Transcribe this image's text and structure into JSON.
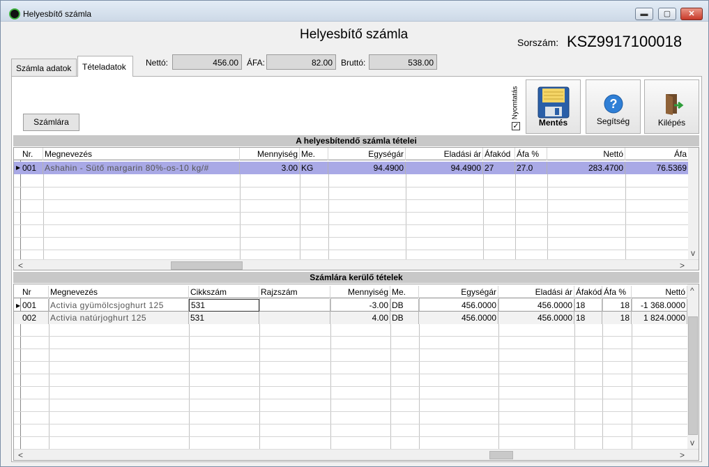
{
  "window": {
    "title": "Helyesbítő számla",
    "minimize": "▬",
    "maximize": "▢",
    "close": "✕"
  },
  "header": {
    "heading": "Helyesbítő számla",
    "sorszam_label": "Sorszám:",
    "sorszam_value": "KSZ9917100018"
  },
  "tabs": [
    {
      "label": "Számla adatok"
    },
    {
      "label": "Tételadatok"
    }
  ],
  "totals": {
    "netto_label": "Nettó:",
    "netto_value": "456.00",
    "afa_label": "ÁFA:",
    "afa_value": "82.00",
    "brutto_label": "Bruttó:",
    "brutto_value": "538.00"
  },
  "toolbar": {
    "szamlara_label": "Számlára",
    "print_label": "Nyomtatás",
    "print_checked": "✓",
    "save_label": "Mentés",
    "help_label": "Segítség",
    "exit_label": "Kilépés"
  },
  "grid1": {
    "title": "A helyesbítendő számla tételei",
    "headers": [
      "Nr.",
      "Megnevezés",
      "Mennyiség",
      "Me.",
      "Egységár",
      "Eladási ár",
      "Áfakód",
      "Áfa %",
      "Nettó",
      "Áfa"
    ],
    "rows": [
      [
        "001",
        "Ashahin - Sütő margarin 80%-os-10 kg/#",
        "3.00",
        "KG",
        "94.4900",
        "94.4900",
        "27",
        "27.0",
        "283.4700",
        "76.5369"
      ]
    ]
  },
  "grid2": {
    "title": "Számlára kerülő tételek",
    "headers": [
      "Nr",
      "Megnevezés",
      "Cikkszám",
      "Rajzszám",
      "Mennyiség",
      "Me.",
      "Egységár",
      "Eladási ár",
      "Áfakód",
      "Áfa %",
      "Nettó"
    ],
    "rows": [
      [
        "001",
        "Activia gyümölcsjoghurt 125",
        "531",
        "",
        "-3.00",
        "DB",
        "456.0000",
        "456.0000",
        "18",
        "18",
        "-1 368.0000"
      ],
      [
        "002",
        "Activia natúrjoghurt 125",
        "531",
        "",
        "4.00",
        "DB",
        "456.0000",
        "456.0000",
        "18",
        "18",
        "1 824.0000"
      ]
    ]
  },
  "scroll": {
    "left": "<",
    "right": ">",
    "up": "^",
    "down": "v"
  }
}
